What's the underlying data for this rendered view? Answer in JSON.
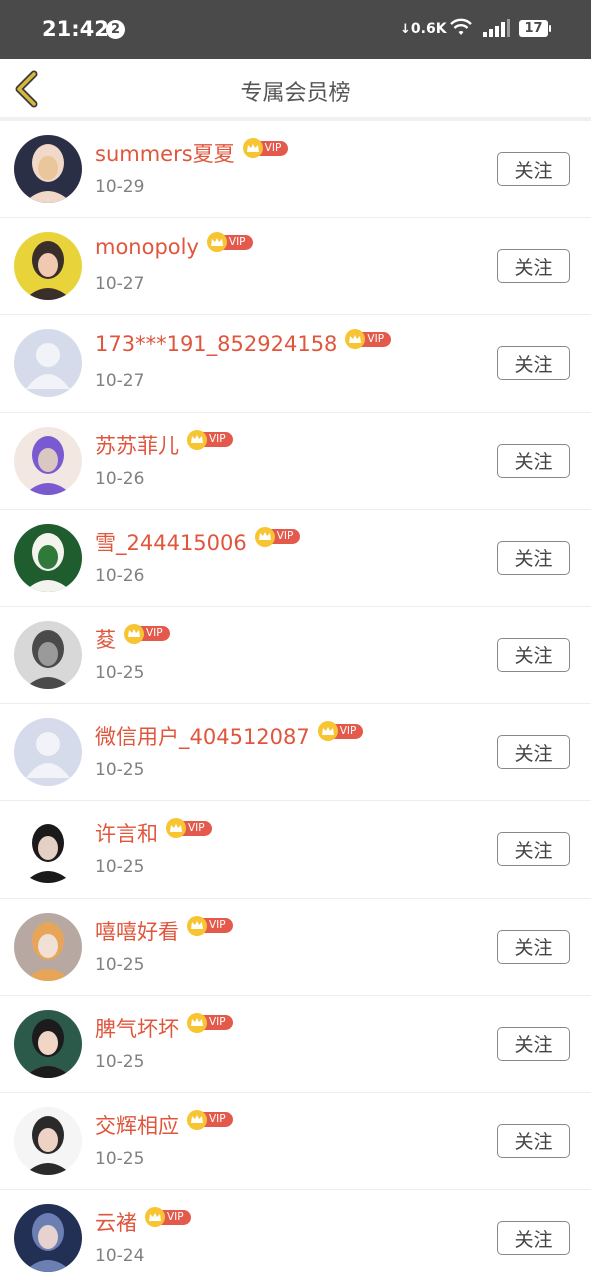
{
  "status_bar": {
    "time": "21:42",
    "notification_count": "2",
    "net_speed": "0.6K",
    "battery": "17"
  },
  "header": {
    "title": "专属会员榜"
  },
  "vip_label": "VIP",
  "follow_label": "关注",
  "members": [
    {
      "name": "summers夏夏",
      "date": "10-29",
      "avatar": "avatar-photo"
    },
    {
      "name": "monopoly",
      "date": "10-27",
      "avatar": "avatar-photo"
    },
    {
      "name": "173***191_852924158",
      "date": "10-27",
      "avatar": "default-avatar-icon"
    },
    {
      "name": "苏苏菲儿",
      "date": "10-26",
      "avatar": "avatar-photo"
    },
    {
      "name": "雪_244415006",
      "date": "10-26",
      "avatar": "avatar-photo"
    },
    {
      "name": "荾",
      "date": "10-25",
      "avatar": "avatar-photo"
    },
    {
      "name": "微信用户_404512087",
      "date": "10-25",
      "avatar": "default-avatar-icon"
    },
    {
      "name": "许言和",
      "date": "10-25",
      "avatar": "avatar-photo"
    },
    {
      "name": "嘻嘻好看",
      "date": "10-25",
      "avatar": "avatar-photo"
    },
    {
      "name": "脾气坏坏",
      "date": "10-25",
      "avatar": "avatar-photo"
    },
    {
      "name": "交辉相应",
      "date": "10-25",
      "avatar": "avatar-photo"
    },
    {
      "name": "云褚",
      "date": "10-24",
      "avatar": "avatar-photo"
    }
  ],
  "colors": {
    "accent_name": "#e0563d",
    "vip_tag": "#e35a4c",
    "crown": "#f7c531",
    "back_arrow": "#d6b93a"
  }
}
